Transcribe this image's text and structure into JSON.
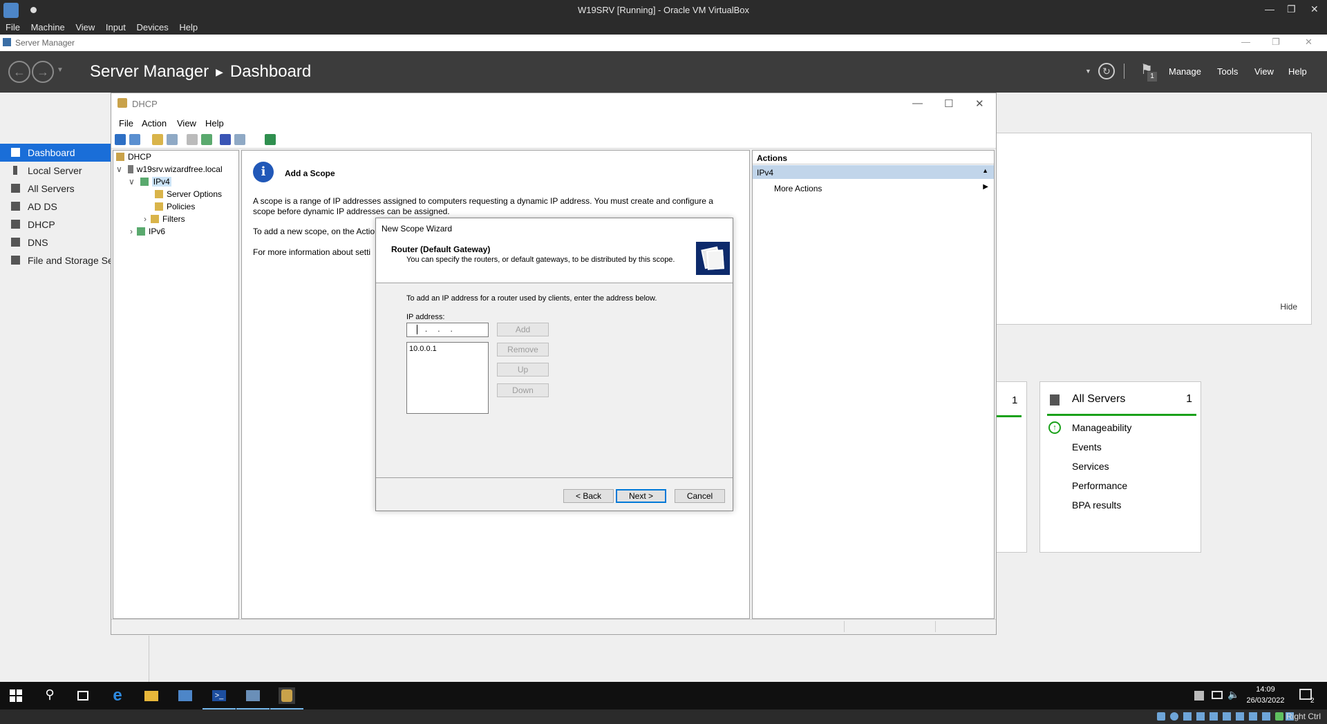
{
  "vbox": {
    "title": "W19SRV [Running] - Oracle VM VirtualBox",
    "menu": [
      "File",
      "Machine",
      "View",
      "Input",
      "Devices",
      "Help"
    ],
    "host_key": "Right Ctrl"
  },
  "server_manager": {
    "window_title": "Server Manager",
    "breadcrumb_root": "Server Manager",
    "breadcrumb_page": "Dashboard",
    "header_menu": [
      "Manage",
      "Tools",
      "View",
      "Help"
    ],
    "notification_count": "1",
    "nav": [
      {
        "label": "Dashboard",
        "icon": "dashboard-icon"
      },
      {
        "label": "Local Server",
        "icon": "server-icon"
      },
      {
        "label": "All Servers",
        "icon": "servers-icon"
      },
      {
        "label": "AD DS",
        "icon": "ad-ds-icon"
      },
      {
        "label": "DHCP",
        "icon": "dhcp-icon"
      },
      {
        "label": "DNS",
        "icon": "dns-icon"
      },
      {
        "label": "File and Storage Ser",
        "icon": "storage-icon"
      }
    ],
    "hide_label": "Hide",
    "tile_left_count": "1",
    "all_servers_tile": {
      "title": "All Servers",
      "count": "1",
      "rows": [
        "Manageability",
        "Events",
        "Services",
        "Performance",
        "BPA results"
      ],
      "status_color": "#1aa11a"
    }
  },
  "dhcp": {
    "window_title": "DHCP",
    "menu": [
      "File",
      "Action",
      "View",
      "Help"
    ],
    "tree": {
      "root": "DHCP",
      "server": "w19srv.wizardfree.local",
      "ipv4": "IPv4",
      "server_options": "Server Options",
      "policies": "Policies",
      "filters": "Filters",
      "ipv6": "IPv6"
    },
    "center": {
      "heading": "Add a Scope",
      "para1": "A scope is a range of IP addresses assigned to computers requesting a dynamic IP address. You must create and configure a",
      "para1b": "scope before dynamic IP addresses can be assigned.",
      "para2": "To add a new scope, on the Actio",
      "para3": "For more information about setti"
    },
    "actions": {
      "title": "Actions",
      "section": "IPv4",
      "item": "More Actions"
    }
  },
  "wizard": {
    "title": "New Scope Wizard",
    "heading": "Router (Default Gateway)",
    "subheading": "You can specify the routers, or default gateways, to be distributed by this scope.",
    "instruction": "To add an IP address for a router used by clients, enter the address below.",
    "ip_label": "IP address:",
    "ip_value": ".     .     .",
    "routers": [
      "10.0.0.1"
    ],
    "buttons": {
      "add": "Add",
      "remove": "Remove",
      "up": "Up",
      "down": "Down",
      "back": "< Back",
      "next": "Next >",
      "cancel": "Cancel"
    }
  },
  "taskbar": {
    "time": "14:09",
    "date": "26/03/2022",
    "notifications": "2"
  }
}
